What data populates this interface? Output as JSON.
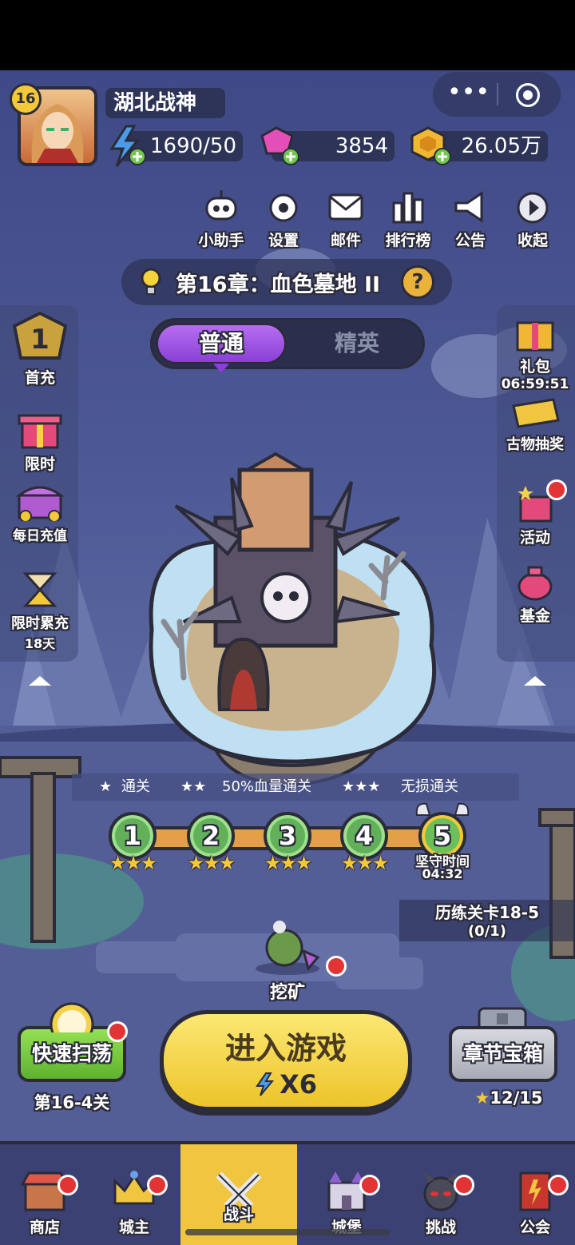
{
  "player": {
    "level": "16",
    "name": "湖北战神"
  },
  "resources": {
    "energy": "1690/50",
    "gems": "3854",
    "gold": "26.05万"
  },
  "toolbar": [
    {
      "label": "小助手",
      "icon": "robot-icon"
    },
    {
      "label": "设置",
      "icon": "gear-icon"
    },
    {
      "label": "邮件",
      "icon": "mail-icon"
    },
    {
      "label": "排行榜",
      "icon": "ranking-icon"
    },
    {
      "label": "公告",
      "icon": "megaphone-icon"
    },
    {
      "label": "收起",
      "icon": "collapse-icon"
    }
  ],
  "chapter": {
    "title": "第16章：血色墓地 II"
  },
  "mode_tabs": {
    "normal": "普通",
    "elite": "精英"
  },
  "left_sidebar": {
    "first_charge_num": "1",
    "first_charge": "首充",
    "limited": "限时",
    "daily_topup": "每日充值",
    "limited_cumulative": "限时累充",
    "limited_cumulative_days": "18天"
  },
  "right_sidebar": {
    "gift_pack": "礼包",
    "gift_timer": "06:59:51",
    "relic_draw": "古物抽奖",
    "events": "活动",
    "fund": "基金"
  },
  "star_legend": {
    "one": "通关",
    "two": "50%血量通关",
    "three": "无损通关"
  },
  "stages": [
    {
      "num": "1",
      "stars": 3
    },
    {
      "num": "2",
      "stars": 3
    },
    {
      "num": "3",
      "stars": 3
    },
    {
      "num": "4",
      "stars": 3
    },
    {
      "num": "5",
      "stars": 0,
      "boss": true,
      "caption": "坚守时间",
      "time": "04:32"
    }
  ],
  "trial": {
    "title": "历练关卡18-5",
    "progress": "(0/1)"
  },
  "mining": {
    "label": "挖矿"
  },
  "sweep": {
    "label": "快速扫荡",
    "stage": "第16-4关"
  },
  "enter": {
    "label": "进入游戏",
    "cost": "X6"
  },
  "chest": {
    "label": "章节宝箱",
    "progress": "12/15"
  },
  "nav": [
    {
      "label": "商店",
      "icon": "shop-icon",
      "badge": true
    },
    {
      "label": "城主",
      "icon": "crown-icon",
      "badge": true
    },
    {
      "label": "战斗",
      "icon": "swords-icon",
      "badge": false,
      "active": true
    },
    {
      "label": "城堡",
      "icon": "castle-icon",
      "badge": true
    },
    {
      "label": "挑战",
      "icon": "demon-icon",
      "badge": true
    },
    {
      "label": "公会",
      "icon": "guild-banner-icon",
      "badge": true
    }
  ],
  "colors": {
    "accent_purple": "#9b4de0",
    "enter_yellow": "#f5d53a",
    "sweep_green": "#7ccf3e",
    "nav_active": "#f0c640",
    "badge_red": "#e23434"
  }
}
